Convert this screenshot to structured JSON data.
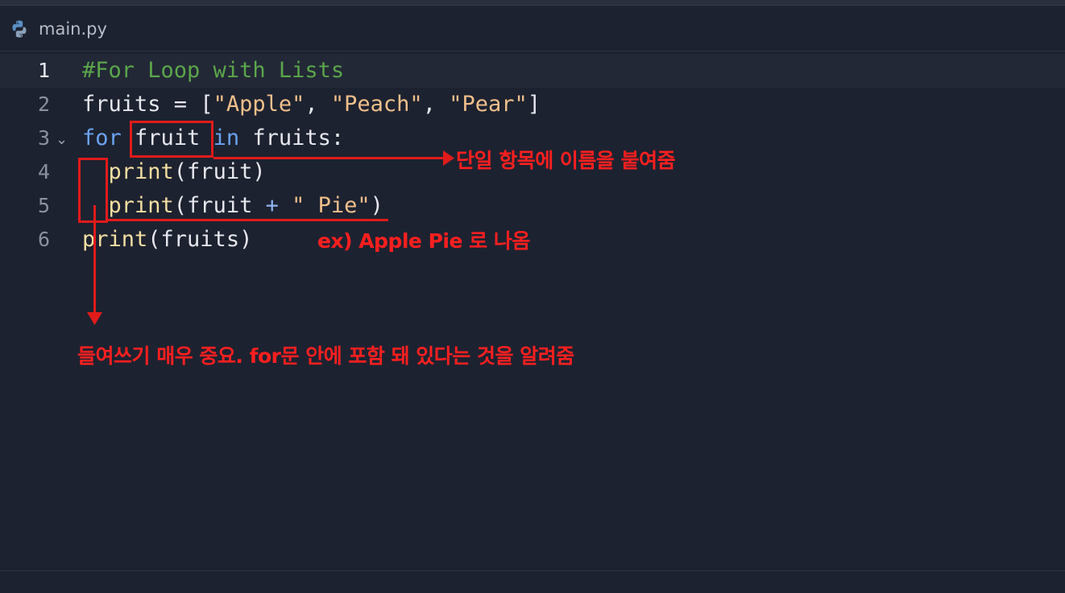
{
  "tab": {
    "filename": "main.py",
    "icon": "python-icon"
  },
  "editor": {
    "lines": [
      {
        "number": "1",
        "tokens": [
          {
            "t": "#For Loop with Lists",
            "c": "comment"
          }
        ]
      },
      {
        "number": "2",
        "tokens": [
          {
            "t": "fruits",
            "c": "plain"
          },
          {
            "t": " = [",
            "c": "plain"
          },
          {
            "t": "\"Apple\"",
            "c": "str"
          },
          {
            "t": ", ",
            "c": "plain"
          },
          {
            "t": "\"Peach\"",
            "c": "str"
          },
          {
            "t": ", ",
            "c": "plain"
          },
          {
            "t": "\"Pear\"",
            "c": "str"
          },
          {
            "t": "]",
            "c": "plain"
          }
        ]
      },
      {
        "number": "3",
        "tokens": [
          {
            "t": "for",
            "c": "kw"
          },
          {
            "t": " fruit ",
            "c": "plain"
          },
          {
            "t": "in",
            "c": "kw"
          },
          {
            "t": " fruits:",
            "c": "plain"
          }
        ]
      },
      {
        "number": "4",
        "tokens": [
          {
            "t": "  ",
            "c": "plain"
          },
          {
            "t": "print",
            "c": "fn"
          },
          {
            "t": "(fruit)",
            "c": "plain"
          }
        ]
      },
      {
        "number": "5",
        "tokens": [
          {
            "t": "  ",
            "c": "plain"
          },
          {
            "t": "print",
            "c": "fn"
          },
          {
            "t": "(fruit ",
            "c": "plain"
          },
          {
            "t": "+",
            "c": "op"
          },
          {
            "t": " ",
            "c": "plain"
          },
          {
            "t": "\" Pie\"",
            "c": "str"
          },
          {
            "t": ")",
            "c": "plain"
          }
        ]
      },
      {
        "number": "6",
        "tokens": [
          {
            "t": "print",
            "c": "fn"
          },
          {
            "t": "(fruits)",
            "c": "plain"
          }
        ]
      }
    ],
    "active_line": 1,
    "fold_marker": "⌄"
  },
  "annotations": {
    "loop_variable_note": "단일 항목에 이름을 붙여줌",
    "output_example_note": "ex) Apple Pie 로 나옴",
    "indentation_note": "들여쓰기 매우 중요. for문 안에 포함 돼 있다는 것을 알려줌"
  },
  "colors": {
    "background": "#1d2230",
    "comment": "#5aa64a",
    "string": "#f0bf8b",
    "keyword": "#6ba3f0",
    "function": "#f2dea0",
    "annotation": "#e11b1b"
  }
}
